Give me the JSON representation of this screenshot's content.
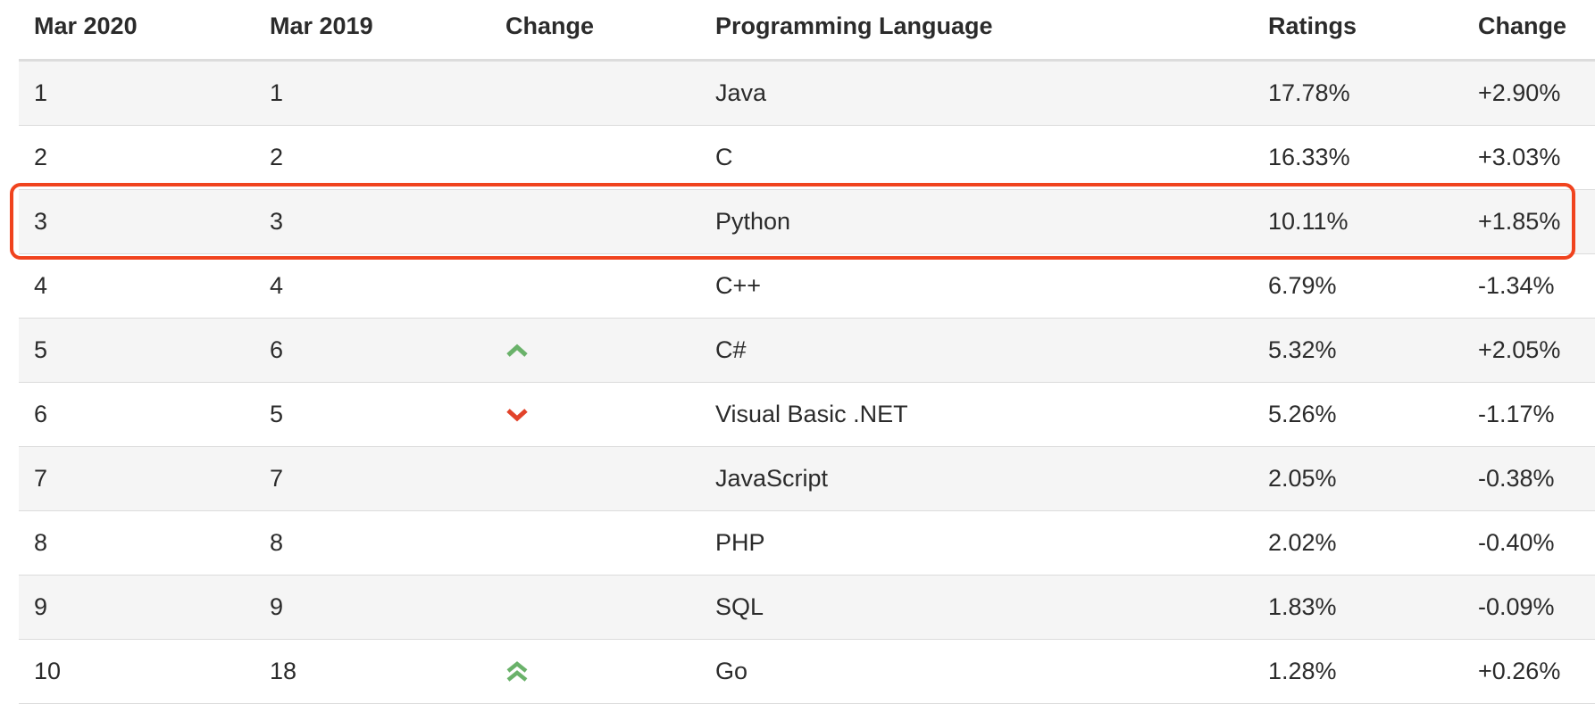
{
  "table": {
    "headers": {
      "mar2020": "Mar 2020",
      "mar2019": "Mar 2019",
      "change": "Change",
      "language": "Programming Language",
      "ratings": "Ratings",
      "ratings_change": "Change"
    },
    "rows": [
      {
        "mar2020": "1",
        "mar2019": "1",
        "trend": "",
        "language": "Java",
        "ratings": "17.78%",
        "change": "+2.90%"
      },
      {
        "mar2020": "2",
        "mar2019": "2",
        "trend": "",
        "language": "C",
        "ratings": "16.33%",
        "change": "+3.03%"
      },
      {
        "mar2020": "3",
        "mar2019": "3",
        "trend": "",
        "language": "Python",
        "ratings": "10.11%",
        "change": "+1.85%"
      },
      {
        "mar2020": "4",
        "mar2019": "4",
        "trend": "",
        "language": "C++",
        "ratings": "6.79%",
        "change": "-1.34%"
      },
      {
        "mar2020": "5",
        "mar2019": "6",
        "trend": "up-chevron-icon",
        "language": "C#",
        "ratings": "5.32%",
        "change": "+2.05%"
      },
      {
        "mar2020": "6",
        "mar2019": "5",
        "trend": "down-chevron-icon",
        "language": "Visual Basic .NET",
        "ratings": "5.26%",
        "change": "-1.17%"
      },
      {
        "mar2020": "7",
        "mar2019": "7",
        "trend": "",
        "language": "JavaScript",
        "ratings": "2.05%",
        "change": "-0.38%"
      },
      {
        "mar2020": "8",
        "mar2019": "8",
        "trend": "",
        "language": "PHP",
        "ratings": "2.02%",
        "change": "-0.40%"
      },
      {
        "mar2020": "9",
        "mar2019": "9",
        "trend": "",
        "language": "SQL",
        "ratings": "1.83%",
        "change": "-0.09%"
      },
      {
        "mar2020": "10",
        "mar2019": "18",
        "trend": "double-up-chevron-icon",
        "language": "Go",
        "ratings": "1.28%",
        "change": "+0.26%"
      }
    ],
    "highlighted_row": "Python"
  },
  "colors": {
    "up": "#6ab26a",
    "down": "#e2432a",
    "highlight": "#f0431e",
    "alt_row": "#f5f5f5",
    "divider": "#dcdcdc"
  }
}
